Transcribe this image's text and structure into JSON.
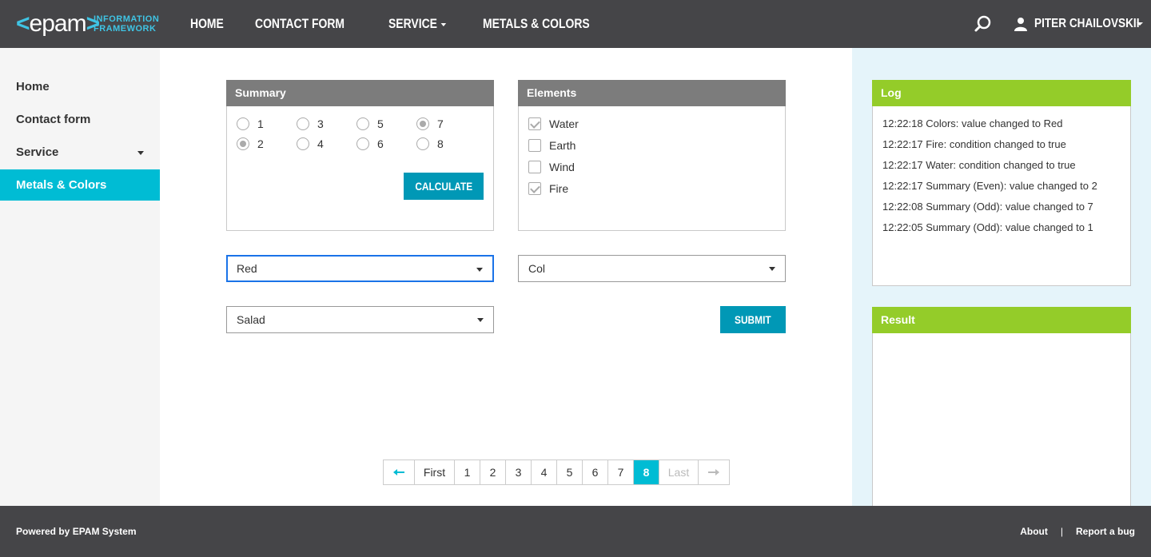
{
  "header": {
    "logo_text": "epam",
    "logo_sub_1": "INFORMATION",
    "logo_sub_2": "FRAMEWORK",
    "nav": [
      "HOME",
      "CONTACT FORM",
      "SERVICE",
      "METALS & COLORS"
    ],
    "user_name": "PITER CHAILOVSKII"
  },
  "sidebar": {
    "items": [
      {
        "label": "Home"
      },
      {
        "label": "Contact form"
      },
      {
        "label": "Service"
      },
      {
        "label": "Metals & Colors"
      }
    ]
  },
  "summary": {
    "title": "Summary",
    "radios_odd": [
      "1",
      "3",
      "5",
      "7"
    ],
    "radios_even": [
      "2",
      "4",
      "6",
      "8"
    ],
    "selected_odd": "7",
    "selected_even": "2",
    "calculate_label": "CALCULATE"
  },
  "elements": {
    "title": "Elements",
    "items": [
      {
        "label": "Water",
        "checked": true
      },
      {
        "label": "Earth",
        "checked": false
      },
      {
        "label": "Wind",
        "checked": false
      },
      {
        "label": "Fire",
        "checked": true
      }
    ]
  },
  "selects": {
    "colors": "Red",
    "metals": "Col",
    "vegetables": "Salad"
  },
  "submit_label": "SUBMIT",
  "pagination": {
    "first": "First",
    "last": "Last",
    "pages": [
      "1",
      "2",
      "3",
      "4",
      "5",
      "6",
      "7",
      "8"
    ],
    "current": "8"
  },
  "log": {
    "title": "Log",
    "lines": [
      "12:22:18 Colors: value changed to Red",
      "12:22:17 Fire: condition changed to true",
      "12:22:17 Water: condition changed to true",
      "12:22:17 Summary (Even): value changed to 2",
      "12:22:08 Summary (Odd): value changed to 7",
      "12:22:05 Summary (Odd): value changed to 1"
    ]
  },
  "result": {
    "title": "Result"
  },
  "footer": {
    "powered": "Powered by EPAM System",
    "about": "About",
    "separator": "|",
    "report": "Report a bug"
  },
  "colors": {
    "header_bg": "#454548",
    "accent": "#00bcd4",
    "button": "#0098b6",
    "panel_head": "#7c7c7c",
    "log_head": "#94cc29",
    "right_bg": "#e5f4fa"
  }
}
